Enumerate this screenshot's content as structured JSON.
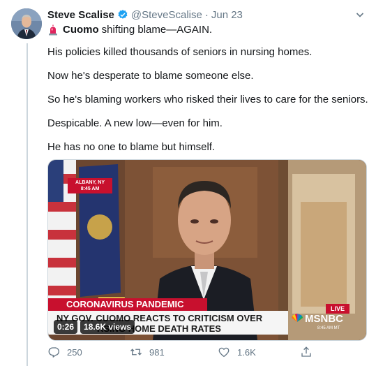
{
  "tweet": {
    "display_name": "Steve Scalise",
    "handle": "@SteveScalise",
    "separator": "·",
    "date": "Jun 23",
    "lead_bold": "Cuomo",
    "lead_rest": "shifting blame—AGAIN.",
    "paragraphs": [
      "His policies killed thousands of seniors in nursing homes.",
      "Now he's desperate to blame someone else.",
      "So he's blaming workers who risked their lives to care for the seniors.",
      "Despicable. A new low—even for him.",
      "He has no one to blame but himself."
    ]
  },
  "media": {
    "location_line1": "ALBANY, NY",
    "location_line2": "8:45 AM",
    "banner_red": "CORONAVIRUS PANDEMIC",
    "banner_line1": "NY GOV. CUOMO REACTS TO CRITICISM OVER",
    "banner_line2": "RSING HOME DEATH RATES",
    "live_label": "LIVE",
    "network": "MSNBC",
    "network_time": "8:45 AM MT",
    "duration": "0:26",
    "views": "18.6K views"
  },
  "actions": {
    "replies": "250",
    "retweets": "981",
    "likes": "1.6K"
  },
  "colors": {
    "text": "#14171a",
    "muted": "#657786",
    "verified": "#1da1f2",
    "siren": "#e0245e",
    "broadcast_red": "#c8102e"
  },
  "icons": [
    "verified-badge-icon",
    "chevron-down-icon",
    "siren-icon",
    "reply-icon",
    "retweet-icon",
    "like-icon",
    "share-icon",
    "peacock-icon"
  ]
}
